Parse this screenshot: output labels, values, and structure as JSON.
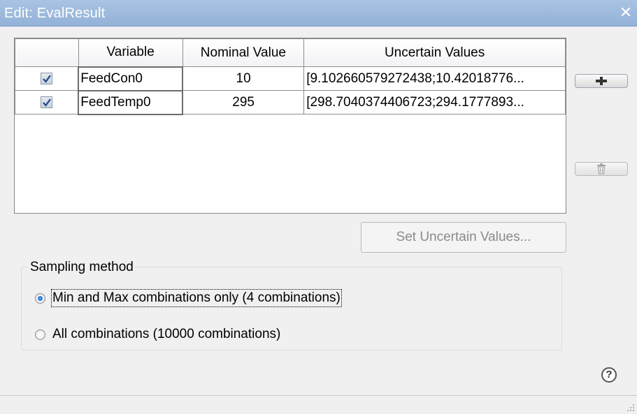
{
  "window": {
    "title": "Edit: EvalResult",
    "close_icon": "close-icon"
  },
  "table": {
    "columns": [
      "",
      "Variable",
      "Nominal Value",
      "Uncertain Values"
    ],
    "rows": [
      {
        "checked": true,
        "variable": "FeedCon0",
        "nominal": "10",
        "uncertain": "[9.102660579272438;10.42018776..."
      },
      {
        "checked": true,
        "variable": "FeedTemp0",
        "nominal": "295",
        "uncertain": "[298.7040374406723;294.1777893..."
      }
    ]
  },
  "buttons": {
    "add_icon": "plus-icon",
    "delete_icon": "trash-icon",
    "set_uncertain": "Set Uncertain Values..."
  },
  "sampling": {
    "legend": "Sampling method",
    "options": [
      {
        "label": "Min and Max combinations only (4 combinations)",
        "selected": true
      },
      {
        "label": "All combinations (10000 combinations)",
        "selected": false
      }
    ]
  },
  "help": {
    "icon": "help-icon",
    "glyph": "?"
  },
  "colors": {
    "titlebar": "#9ab8de",
    "checkbox_mark": "#2c4f8a",
    "radio_selected": "#1058b7"
  }
}
